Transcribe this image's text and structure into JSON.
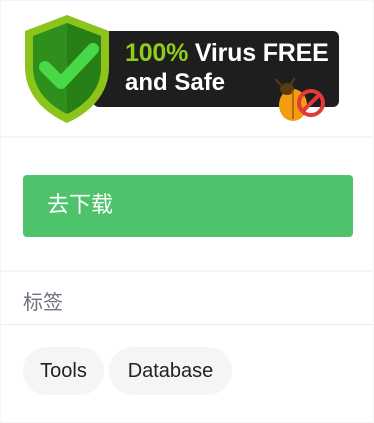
{
  "badge": {
    "line1_accent": "100%",
    "line1_rest": " Virus FREE",
    "line2": "and Safe",
    "colors": {
      "bar": "#1e1e1e",
      "accent": "#92cc1a",
      "shield_outer": "#7fbf1a",
      "shield_inner": "#2f8f1c",
      "check": "#3ccc3c",
      "bug_body": "#f39c12",
      "no_sign": "#e53935"
    },
    "icons": [
      "shield-check-icon",
      "bug-blocked-icon"
    ]
  },
  "download": {
    "button_label": "去下载",
    "color": "#4fc36c"
  },
  "tags": {
    "title": "标签",
    "items": [
      {
        "label": "Tools"
      },
      {
        "label": "Database"
      }
    ]
  }
}
